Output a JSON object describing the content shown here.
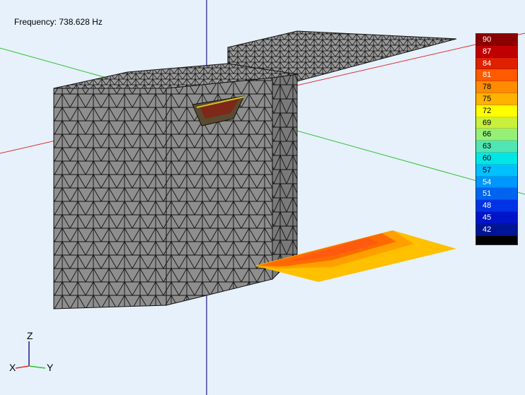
{
  "viewer": {
    "frequency_label": "Frequency: 738.628 Hz"
  },
  "legend": {
    "entries": [
      {
        "value": "90",
        "color": "#8b0000"
      },
      {
        "value": "87",
        "color": "#c00000"
      },
      {
        "value": "84",
        "color": "#e02000"
      },
      {
        "value": "81",
        "color": "#ff5a00"
      },
      {
        "value": "78",
        "color": "#ff8c00"
      },
      {
        "value": "75",
        "color": "#ffb300"
      },
      {
        "value": "72",
        "color": "#ffff00"
      },
      {
        "value": "69",
        "color": "#c8f03c"
      },
      {
        "value": "66",
        "color": "#96f078"
      },
      {
        "value": "63",
        "color": "#50e6b4"
      },
      {
        "value": "60",
        "color": "#00e6e6"
      },
      {
        "value": "57",
        "color": "#00c0ff"
      },
      {
        "value": "54",
        "color": "#0096ff"
      },
      {
        "value": "51",
        "color": "#0064f0"
      },
      {
        "value": "48",
        "color": "#0032e6"
      },
      {
        "value": "45",
        "color": "#0014c8"
      },
      {
        "value": "42",
        "color": "#001496"
      }
    ]
  },
  "axes": {
    "z": "Z",
    "x": "X",
    "y": "Y"
  },
  "colors": {
    "background": "#e6f1fb",
    "mesh_fill": "#8c8c8c",
    "mesh_line": "#111111",
    "axis_red": "#e03030",
    "axis_green": "#30c030",
    "axis_blue": "#1a1a8c"
  }
}
